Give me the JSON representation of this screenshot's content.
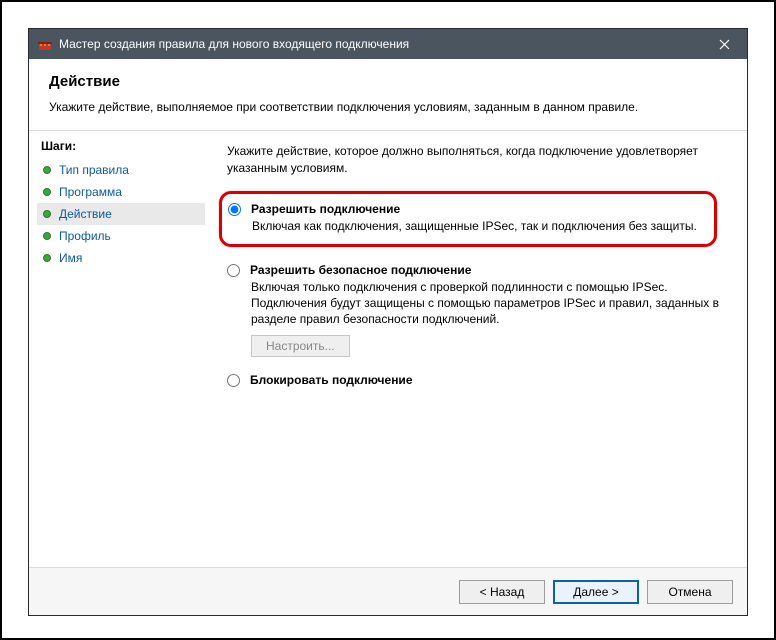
{
  "titlebar": {
    "title": "Мастер создания правила для нового входящего подключения"
  },
  "header": {
    "title": "Действие",
    "subtitle": "Укажите действие, выполняемое при соответствии подключения условиям, заданным в данном правиле."
  },
  "sidebar": {
    "label": "Шаги:",
    "steps": [
      "Тип правила",
      "Программа",
      "Действие",
      "Профиль",
      "Имя"
    ]
  },
  "content": {
    "intro": "Укажите действие, которое должно выполняться, когда подключение удовлетворяет указанным условиям.",
    "options": [
      {
        "label": "Разрешить подключение",
        "desc": "Включая как подключения, защищенные IPSec, так и подключения без защиты."
      },
      {
        "label": "Разрешить безопасное подключение",
        "desc": "Включая только подключения с проверкой подлинности с помощью IPSec. Подключения будут защищены с помощью параметров IPSec и правил, заданных в разделе правил безопасности подключений."
      },
      {
        "label": "Блокировать подключение",
        "desc": ""
      }
    ],
    "configure_label": "Настроить..."
  },
  "footer": {
    "back": "< Назад",
    "next": "Далее >",
    "cancel": "Отмена"
  }
}
